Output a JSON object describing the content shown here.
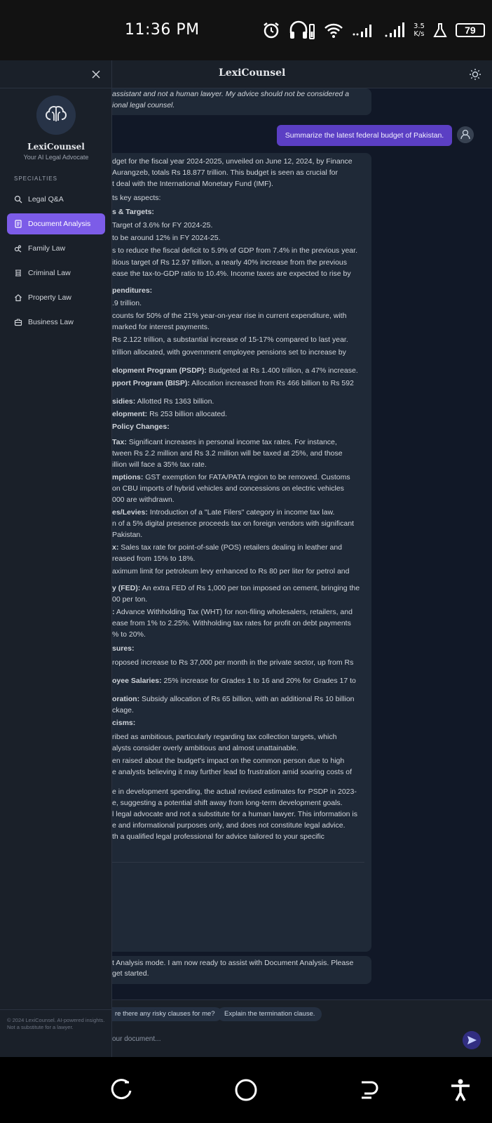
{
  "status_bar": {
    "time": "11:36 PM",
    "net_speed_value": "3.5",
    "net_speed_unit": "K/s",
    "battery": "79",
    "icons": [
      "alarm-icon",
      "headphones-battery-icon",
      "wifi-icon",
      "signal-icon",
      "signal-icon",
      "flask-icon",
      "battery-icon"
    ]
  },
  "app": {
    "title": "LexiCounsel",
    "theme_icon": "sun-icon"
  },
  "sidebar": {
    "brand": "LexiCounsel",
    "tagline": "Your AI Legal Advocate",
    "section_label": "SPECIALTIES",
    "items": [
      {
        "label": "Legal Q&A",
        "icon": "search-icon",
        "active": false
      },
      {
        "label": "Document Analysis",
        "icon": "document-icon",
        "active": true
      },
      {
        "label": "Family Law",
        "icon": "family-icon",
        "active": false
      },
      {
        "label": "Criminal Law",
        "icon": "gavel-icon",
        "active": false
      },
      {
        "label": "Property Law",
        "icon": "home-icon",
        "active": false
      },
      {
        "label": "Business Law",
        "icon": "briefcase-icon",
        "active": false
      }
    ],
    "footer": "© 2024 LexiCounsel. AI-powered insights. Not a substitute for a lawyer.",
    "accent_color": "#7c5ce8"
  },
  "chat": {
    "intro_lines": [
      "assistant and not a human lawyer. My advice should not be considered a",
      "ional legal counsel."
    ],
    "user_message": "Summarize the latest federal budget of Pakistan.",
    "answer_lines": [
      {
        "text": "dget for the fiscal year 2024-2025, unveiled on June 12, 2024, by Finance",
        "bold": ""
      },
      {
        "text": "Aurangzeb, totals Rs 18.877 trillion. This budget is seen as crucial for",
        "bold": ""
      },
      {
        "text": "t deal with the International Monetary Fund (IMF).",
        "bold": ""
      },
      {
        "text": "ts key aspects:",
        "bold": ""
      },
      {
        "text": "",
        "bold": "s & Targets:"
      },
      {
        "text": " Target of 3.6% for FY 2024-25.",
        "bold": ""
      },
      {
        "text": " to be around 12% in FY 2024-25.",
        "bold": ""
      },
      {
        "text": "s to reduce the fiscal deficit to 5.9% of GDP from 7.4% in the previous year.",
        "bold": ""
      },
      {
        "text": "itious target of Rs 12.97 trillion, a nearly 40% increase from the previous",
        "bold": ""
      },
      {
        "text": "ease the tax-to-GDP ratio to 10.4%. Income taxes are expected to rise by",
        "bold": ""
      },
      {
        "text": "",
        "bold": "penditures:"
      },
      {
        "text": ".9 trillion.",
        "bold": ""
      },
      {
        "text": "counts for 50% of the 21% year-on-year rise in current expenditure, with",
        "bold": ""
      },
      {
        "text": "marked for interest payments.",
        "bold": ""
      },
      {
        "text": " Rs 2.122 trillion, a substantial increase of 15-17% compared to last year.",
        "bold": ""
      },
      {
        "text": " trillion allocated, with government employee pensions set to increase by",
        "bold": ""
      },
      {
        "text": " Budgeted at Rs 1.400 trillion, a 47% increase.",
        "bold": "elopment Program (PSDP):"
      },
      {
        "text": " Allocation increased from Rs 466 billion to Rs 592",
        "bold": "pport Program (BISP):"
      },
      {
        "text": " Allotted Rs 1363 billion.",
        "bold": "sidies:"
      },
      {
        "text": " Rs 253 billion allocated.",
        "bold": "elopment:"
      },
      {
        "text": "",
        "bold": " Policy Changes:"
      },
      {
        "text": " Significant increases in personal income tax rates. For instance,",
        "bold": "Tax:"
      },
      {
        "text": "tween Rs 2.2 million and Rs 3.2 million will be taxed at 25%, and those",
        "bold": ""
      },
      {
        "text": "illion will face a 35% tax rate.",
        "bold": ""
      },
      {
        "text": " GST exemption for FATA/PATA region to be removed. Customs",
        "bold": "mptions:"
      },
      {
        "text": "on CBU imports of hybrid vehicles and concessions on electric vehicles",
        "bold": ""
      },
      {
        "text": "000 are withdrawn.",
        "bold": ""
      },
      {
        "text": " Introduction of a \"Late Filers\" category in income tax law.",
        "bold": "es/Levies:"
      },
      {
        "text": "n of a 5% digital presence proceeds tax on foreign vendors with significant",
        "bold": ""
      },
      {
        "text": "Pakistan.",
        "bold": ""
      },
      {
        "text": " Sales tax rate for point-of-sale (POS) retailers dealing in leather and",
        "bold": "x:"
      },
      {
        "text": "reased from 15% to 18%.",
        "bold": ""
      },
      {
        "text": "aximum limit for petroleum levy enhanced to Rs 80 per liter for petrol and",
        "bold": ""
      },
      {
        "text": " An extra FED of Rs 1,000 per ton imposed on cement, bringing the",
        "bold": "y (FED):"
      },
      {
        "text": "00 per ton.",
        "bold": ""
      },
      {
        "text": " Advance Withholding Tax (WHT) for non-filing wholesalers, retailers, and",
        "bold": ":"
      },
      {
        "text": "ease from 1% to 2.25%. Withholding tax rates for profit on debt payments",
        "bold": ""
      },
      {
        "text": "% to 20%.",
        "bold": ""
      },
      {
        "text": "",
        "bold": "sures:"
      },
      {
        "text": "roposed increase to Rs 37,000 per month in the private sector, up from Rs",
        "bold": ""
      },
      {
        "text": " 25% increase for Grades 1 to 16 and 20% for Grades 17 to",
        "bold": "oyee Salaries:"
      },
      {
        "text": " Subsidy allocation of Rs 65 billion, with an additional Rs 10 billion",
        "bold": "oration:"
      },
      {
        "text": "ckage.",
        "bold": ""
      },
      {
        "text": "",
        "bold": "cisms:"
      },
      {
        "text": "ribed as ambitious, particularly regarding tax collection targets, which",
        "bold": ""
      },
      {
        "text": "alysts consider overly ambitious and almost unattainable.",
        "bold": ""
      },
      {
        "text": "en raised about the budget's impact on the common person due to high",
        "bold": ""
      },
      {
        "text": "e analysts believing it may further lead to frustration amid soaring costs of",
        "bold": ""
      },
      {
        "text": "e in development spending, the actual revised estimates for PSDP in 2023-",
        "bold": ""
      },
      {
        "text": "e, suggesting a potential shift away from long-term development goals.",
        "bold": ""
      },
      {
        "text": "l legal advocate and not a substitute for a human lawyer. This information is",
        "bold": ""
      },
      {
        "text": "e and informational purposes only, and does not constitute legal advice.",
        "bold": ""
      },
      {
        "text": "th a qualified legal professional for advice tailored to your specific",
        "bold": ""
      }
    ],
    "mode_lines": [
      "t Analysis mode. I am now ready to assist with Document Analysis. Please",
      " get started."
    ]
  },
  "composer": {
    "suggestions": [
      "re there any risky clauses for me?",
      "Explain the termination clause."
    ],
    "placeholder": "our document..."
  },
  "android_nav": {
    "buttons": [
      "recents-icon",
      "home-icon",
      "back-icon",
      "accessibility-icon"
    ]
  }
}
